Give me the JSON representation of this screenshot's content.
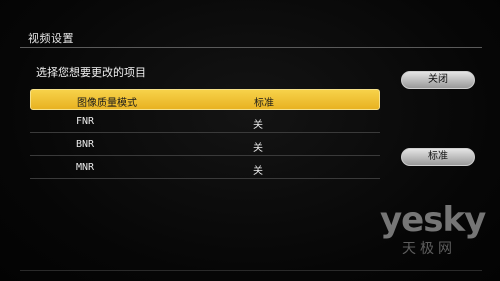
{
  "window": {
    "title": "视频设置"
  },
  "prompt": "选择您想要更改的项目",
  "settings": [
    {
      "name": "图像质量模式",
      "value": "标准",
      "selected": true
    },
    {
      "name": "FNR",
      "value": "关",
      "selected": false
    },
    {
      "name": "BNR",
      "value": "关",
      "selected": false
    },
    {
      "name": "MNR",
      "value": "关",
      "selected": false
    }
  ],
  "buttons": {
    "close": "关闭",
    "standard": "标准"
  },
  "watermark": {
    "logo": "yesky",
    "sub": "天极网"
  },
  "colors": {
    "highlight": "#f0c23a",
    "background": "#050505"
  }
}
